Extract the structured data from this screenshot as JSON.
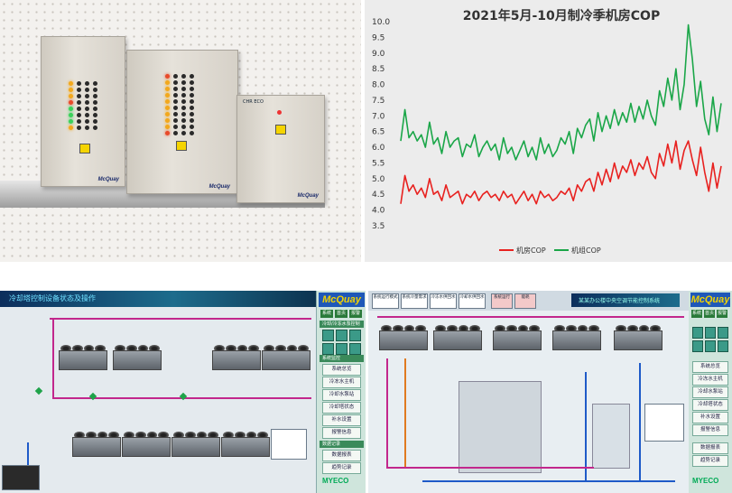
{
  "photo": {
    "cabinet_brand": "McQuay",
    "ecc_label": "CHR ECO"
  },
  "chart_data": {
    "type": "line",
    "title": "2021年5月-10月制冷季机房COP",
    "xlabel": "",
    "ylabel": "",
    "ylim": [
      3.5,
      10.0
    ],
    "yticks": [
      "10.0",
      "9.5",
      "9.0",
      "8.5",
      "8.0",
      "7.5",
      "7.0",
      "6.5",
      "6.0",
      "5.5",
      "5.0",
      "4.5",
      "4.0",
      "3.5"
    ],
    "legend_position": "bottom",
    "grid": false,
    "series": [
      {
        "name": "机房COP",
        "color": "#e8211f",
        "values": [
          4.2,
          5.1,
          4.6,
          4.8,
          4.5,
          4.7,
          4.4,
          5.0,
          4.5,
          4.6,
          4.3,
          4.8,
          4.4,
          4.5,
          4.6,
          4.2,
          4.5,
          4.4,
          4.6,
          4.3,
          4.5,
          4.6,
          4.4,
          4.5,
          4.3,
          4.6,
          4.4,
          4.5,
          4.2,
          4.4,
          4.6,
          4.3,
          4.5,
          4.2,
          4.6,
          4.4,
          4.5,
          4.3,
          4.4,
          4.6,
          4.5,
          4.7,
          4.3,
          4.8,
          4.6,
          4.9,
          5.0,
          4.6,
          5.2,
          4.8,
          5.3,
          4.9,
          5.5,
          5.0,
          5.4,
          5.2,
          5.6,
          5.1,
          5.5,
          5.3,
          5.7,
          5.2,
          5.0,
          5.8,
          5.4,
          6.1,
          5.5,
          6.2,
          5.3,
          5.9,
          6.2,
          5.6,
          5.1,
          6.0,
          5.2,
          4.6,
          5.5,
          4.7,
          5.4
        ]
      },
      {
        "name": "机组COP",
        "color": "#1aa648",
        "values": [
          6.2,
          7.2,
          6.3,
          6.5,
          6.2,
          6.4,
          6.0,
          6.8,
          6.1,
          6.3,
          5.8,
          6.5,
          6.0,
          6.2,
          6.3,
          5.7,
          6.1,
          6.0,
          6.4,
          5.7,
          6.0,
          6.2,
          5.9,
          6.1,
          5.6,
          6.3,
          5.8,
          6.0,
          5.6,
          5.9,
          6.2,
          5.7,
          6.0,
          5.6,
          6.3,
          5.8,
          6.1,
          5.7,
          5.9,
          6.3,
          6.1,
          6.5,
          5.8,
          6.6,
          6.3,
          6.7,
          6.9,
          6.2,
          7.1,
          6.5,
          7.0,
          6.6,
          7.2,
          6.7,
          7.1,
          6.8,
          7.4,
          6.8,
          7.3,
          6.9,
          7.5,
          7.0,
          6.7,
          7.8,
          7.3,
          8.2,
          7.5,
          8.5,
          7.2,
          8.0,
          9.9,
          8.8,
          7.3,
          8.1,
          6.9,
          6.4,
          7.6,
          6.5,
          7.4
        ]
      }
    ]
  },
  "hmi_left": {
    "title": "冷却塔控制设备状态及操作",
    "logo": "McQuay",
    "tabs": [
      "系统",
      "首页",
      "报警"
    ],
    "section1": "冷却/冷冻水泵控制",
    "section2": "系统监控",
    "menu": [
      "系统总览",
      "冷冻水主机",
      "冷却水泵站",
      "冷却塔状态",
      "补水设置",
      "报警信息"
    ],
    "section3": "数据记录",
    "menu2": [
      "数据报表",
      "趋势记录"
    ],
    "footer_logo": "MYECO"
  },
  "hmi_mid": {
    "title": "某某办公楼中央空调节能控制系统",
    "top_boxes": [
      "系统运行模式",
      "系统冷量需求",
      "冷冻水供回水",
      "冷却水供回水",
      "系统运行",
      "能耗"
    ]
  },
  "hmi_right": {
    "logo": "McQuay",
    "tabs": [
      "系统",
      "首页",
      "报警"
    ],
    "menu": [
      "系统总览",
      "冷冻水主机",
      "冷却水泵站",
      "冷却塔状态",
      "补水设置",
      "报警信息",
      "数据报表",
      "趋势记录"
    ],
    "footer_logo": "MYECO"
  }
}
